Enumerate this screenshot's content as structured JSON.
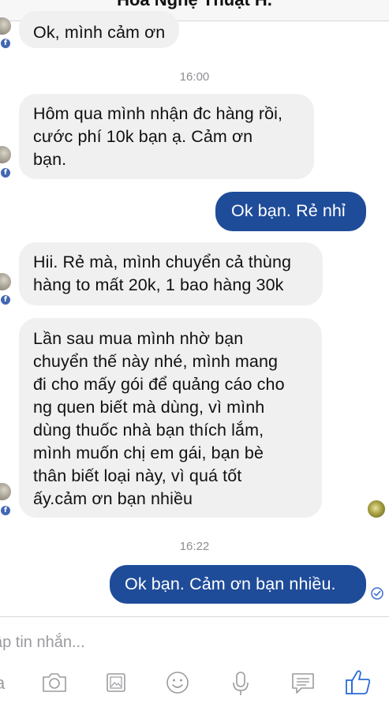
{
  "header": {
    "title": "Hoa Nghệ Thuật H."
  },
  "messages": [
    {
      "text": "Ok, mình cảm ơn"
    },
    {
      "text": "Hôm qua mình nhận đc hàng rồi,\ncước phí 10k bạn ạ. Cảm ơn\nbạn."
    },
    {
      "text": "Ok bạn. Rẻ nhỉ"
    },
    {
      "text": "Hii. Rẻ mà, mình chuyển cả thùng\nhàng to mất 20k, 1 bao hàng 30k"
    },
    {
      "text": "Lần sau mua mình nhờ bạn\nchuyển thế này nhé, mình mang\nđi cho mấy gói để quảng cáo cho\nng quen biết mà dùng, vì mình\ndùng thuốc nhà bạn thích lắm,\nmình muốn chị em gái, bạn bè\nthân biết loại này, vì quá tốt\nấy.cảm ơn bạn nhiều"
    },
    {
      "text": "Ok bạn. Cảm ơn bạn nhiều."
    }
  ],
  "timestamps": [
    "16:00",
    "16:22"
  ],
  "composer": {
    "placeholder": "ập tin nhắn..."
  },
  "badges": {
    "facebook": "f"
  },
  "colors": {
    "outgoing": "#1f4c99",
    "incoming": "#f1f0f0",
    "accent": "#4267b2"
  },
  "toolbar_icons": [
    "camera-icon",
    "photo-icon",
    "emoji-icon",
    "microphone-icon",
    "sticker-icon",
    "like-icon"
  ]
}
